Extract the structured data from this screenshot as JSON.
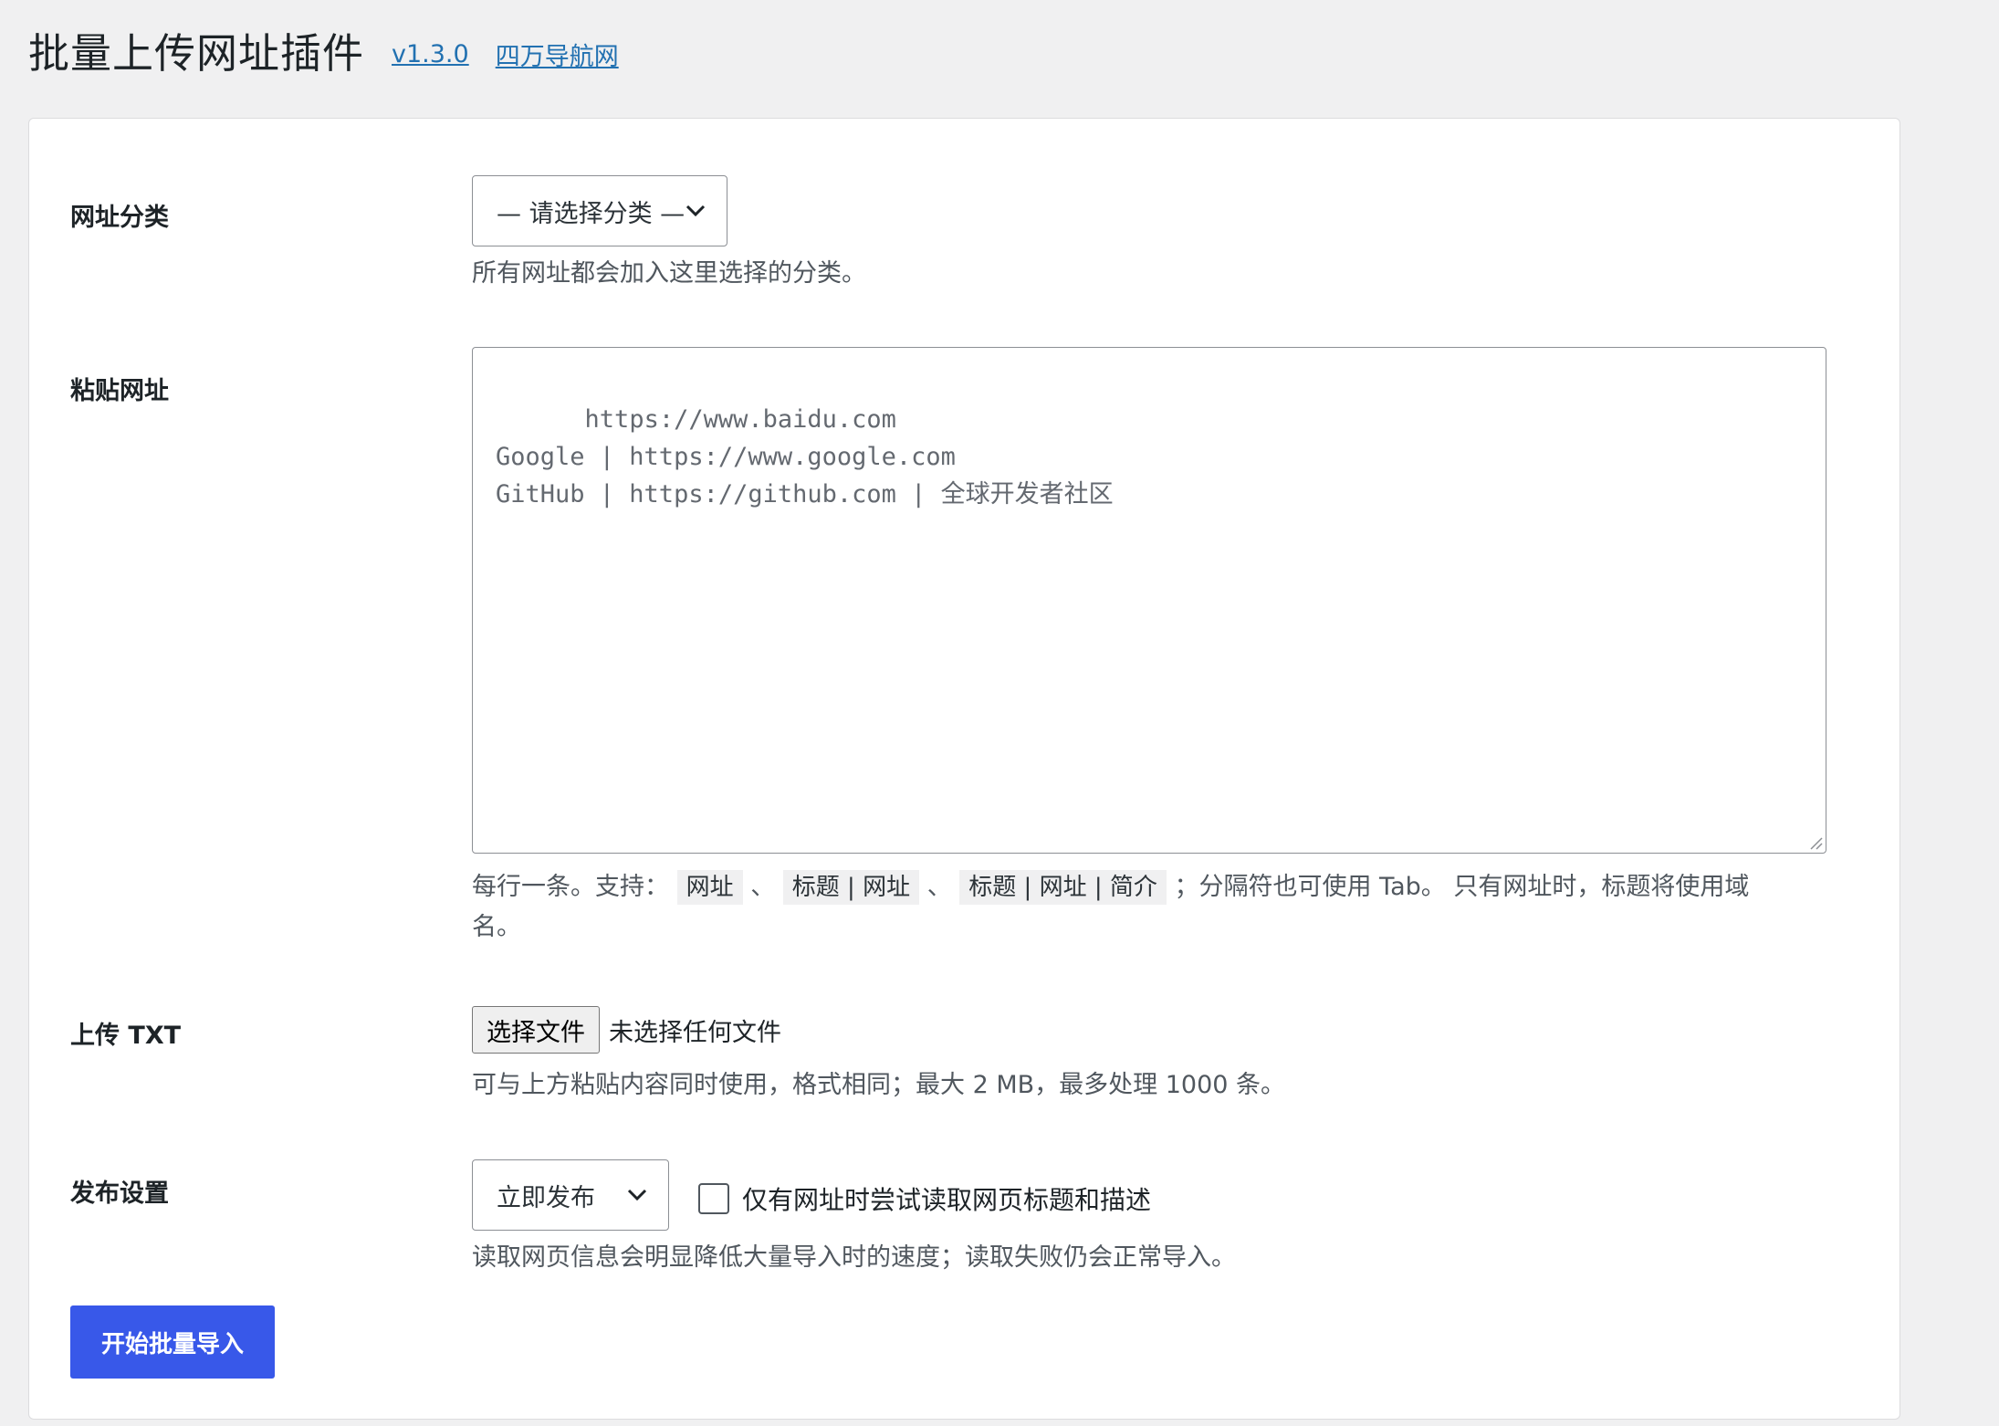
{
  "header": {
    "title": "批量上传网址插件",
    "version_link": "v1.3.0",
    "site_link": "四万导航网"
  },
  "category": {
    "label": "网址分类",
    "select_value": "— 请选择分类 —",
    "description": "所有网址都会加入这里选择的分类。"
  },
  "paste": {
    "label": "粘贴网址",
    "placeholder": "https://www.baidu.com\nGoogle | https://www.google.com\nGitHub | https://github.com | 全球开发者社区",
    "help_prefix": "每行一条。支持：",
    "format_1": "网址",
    "sep_1": "、",
    "format_2": "标题 | 网址",
    "sep_2": "、",
    "format_3": "标题 | 网址 | 简介",
    "help_suffix_line1": "；分隔符也可使用 Tab。 只有网址时，标题将使用域",
    "help_suffix_line2": "名。"
  },
  "upload": {
    "label": "上传 TXT",
    "button_label": "选择文件",
    "file_status": "未选择任何文件",
    "description": "可与上方粘贴内容同时使用，格式相同；最大 2 MB，最多处理 1000 条。"
  },
  "publish": {
    "label": "发布设置",
    "select_value": "立即发布",
    "checkbox_label": "仅有网址时尝试读取网页标题和描述",
    "checkbox_checked": false,
    "description": "读取网页信息会明显降低大量导入时的速度；读取失败仍会正常导入。"
  },
  "submit": {
    "label": "开始批量导入"
  },
  "colors": {
    "background": "#f0f0f1",
    "link": "#2271b1",
    "primary_button": "#3858e9"
  },
  "icons": {
    "select_arrow": "chevron-down-icon",
    "resize": "resize-handle-icon"
  }
}
